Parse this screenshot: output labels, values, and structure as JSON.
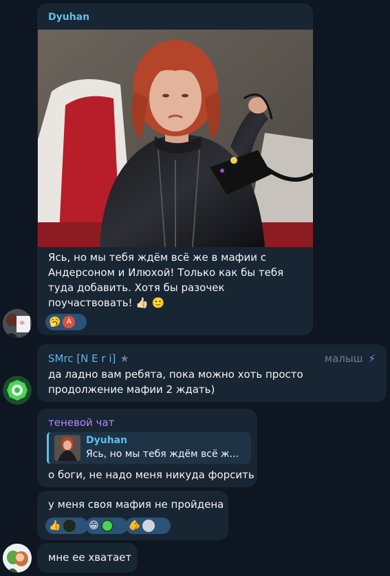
{
  "messages": [
    {
      "sender": "Dyuhan",
      "text": "Ясь, но мы тебя ждём всё же в мафии с Андерсоном и Илюхой! Только как бы тебя туда добавить. Хотя бы разочек поучаствовать! 👍🏻 🙂",
      "reactions": [
        {
          "emoji": "🥱",
          "avatar_letter": "A"
        }
      ]
    },
    {
      "sender": "SMrc [N E r i]",
      "tag": "малыш",
      "text": "да ладно вам ребята, пока можно хоть просто продолжение мафии 2  ждать)"
    },
    {
      "sender": "теневой чат",
      "reply": {
        "author": "Dyuhan",
        "text": "Ясь, но мы тебя ждём всё ж..."
      },
      "text": "о боги, не надо меня никуда форсить"
    },
    {
      "text": "у меня своя мафия не пройдена",
      "reactions": [
        "👍",
        "😁",
        "🫵"
      ]
    },
    {
      "text": "мне ее хватает"
    }
  ],
  "colors": {
    "bg": "#0e1621",
    "bubble": "#182533",
    "dyuhan": "#5ec0e8",
    "smrc": "#63b3ec",
    "shadow_chat": "#b388ff",
    "reaction_bg": "#2b5278"
  }
}
